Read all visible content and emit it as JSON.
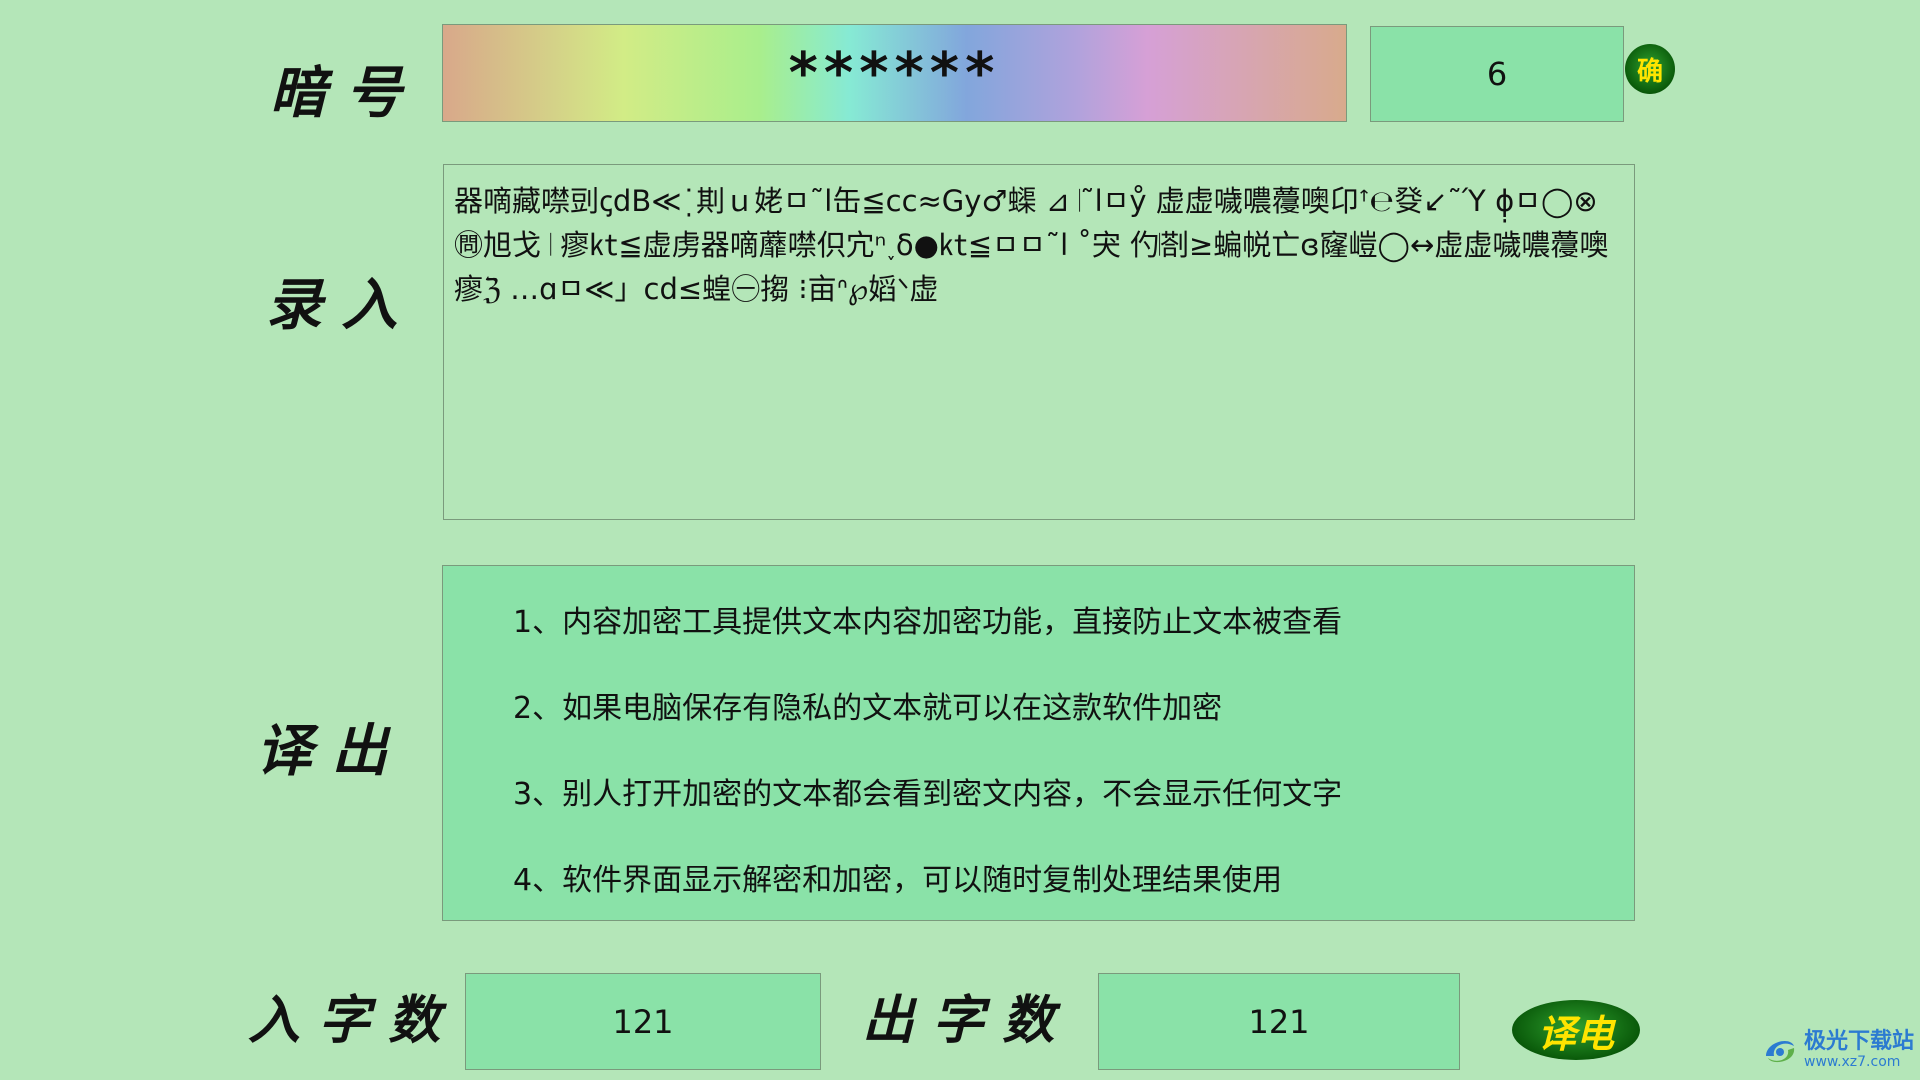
{
  "labels": {
    "password": "暗 号",
    "input": "录 入",
    "output": "译 出",
    "input_count": "入 字 数",
    "output_count": "出 字 数"
  },
  "password": {
    "value": "******",
    "length": "6",
    "confirm_label": "确"
  },
  "input_text": "器嘀藏噤剅ꞔdB≪˙̣剘ｕ姥ㅁ˜l缶≦cc≈Gy♂蟝 ⊿ 𝄀˜lㅁẙ 虚虚噦噥蘉噢卬ꜛ℮癹↙˜Ύ ɸ̣ㅁ◯⊗㉄旭戈 𝄀 瘳㏏≦虚虏器嘀蘼噤伿宂ⁿ˯δ●㏏≦ㅁㅁ˜l ˚宊 仢𝄀剳≥蝙帨亡ɞ窿嵦◯↔虚虚噦噥蘉噢 瘳ℨ …ɑㅁ≪」cd≤蝗㊀搊 ⁝亩ᐢ℘嫍ᐠ虚",
  "output_lines": [
    "1、内容加密工具提供文本内容加密功能，直接防止文本被查看",
    "2、如果电脑保存有隐私的文本就可以在这款软件加密",
    "3、别人打开加密的文本都会看到密文内容，不会显示任何文字",
    "4、软件界面显示解密和加密，可以随时复制处理结果使用"
  ],
  "counts": {
    "input": "121",
    "output": "121"
  },
  "translate_button": "译电",
  "watermark": {
    "name": "极光下载站",
    "url": "www.xz7.com"
  },
  "colors": {
    "background": "#b4e6b8",
    "field": "#8ae2a8",
    "button_green": "#0a5a0a",
    "button_text": "#ffe400",
    "watermark_blue": "#2c7bd1"
  }
}
